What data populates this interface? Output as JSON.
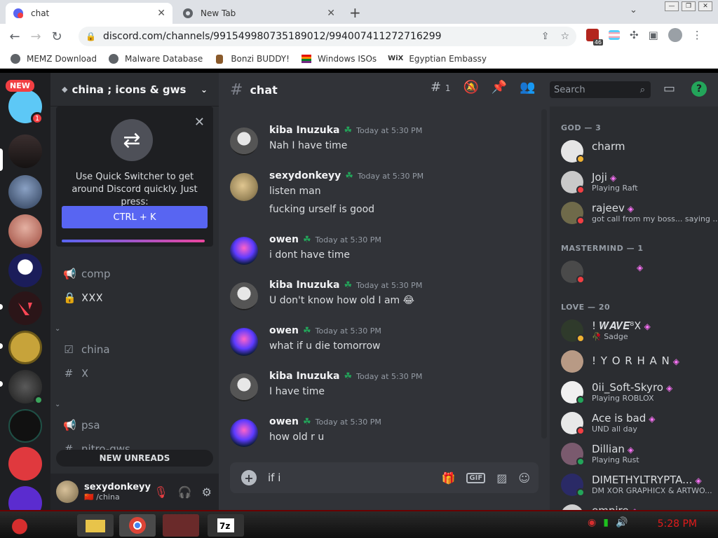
{
  "browser": {
    "tabs": [
      {
        "label": "chat",
        "active": true
      },
      {
        "label": "New Tab",
        "active": false
      }
    ],
    "url": "discord.com/channels/991549980735189012/994007411272716299",
    "extension_badge": "46",
    "bookmarks": [
      {
        "label": "MEMZ Download",
        "icon": "globe-icon"
      },
      {
        "label": "Malware Database",
        "icon": "globe-icon"
      },
      {
        "label": "Bonzi BUDDY!",
        "icon": "bonzi-icon"
      },
      {
        "label": "Windows ISOs",
        "icon": "windows-flag-icon"
      },
      {
        "label": "Egyptian Embassy",
        "icon": "wix-icon"
      }
    ],
    "bookmark_wix_label": "WiX"
  },
  "servers": {
    "new_label": "NEW",
    "badges": [
      "1",
      "1"
    ]
  },
  "sidebar": {
    "guild_name": "china ; icons & gws",
    "quick_switcher": {
      "text": "Use Quick Switcher to get around Discord quickly. Just press:",
      "shortcut": "CTRL + K"
    },
    "channels": [
      {
        "icon": "megaphone-icon",
        "label": "comp"
      },
      {
        "icon": "lock-icon",
        "label": "𐌗𐌗𐌗"
      },
      {
        "icon": "checkbox-icon",
        "label": "china"
      },
      {
        "icon": "hash-icon",
        "label": "𐌗"
      },
      {
        "icon": "megaphone-icon",
        "label": "psa"
      },
      {
        "icon": "hash-icon",
        "label": "nitro-gws"
      }
    ],
    "new_unreads": "NEW UNREADS",
    "user": {
      "name": "sexydonkeyy",
      "status": "/china",
      "flag": "🇨🇳"
    }
  },
  "chat": {
    "channel": "chat",
    "thread_count": "1",
    "search_placeholder": "Search",
    "messages": [
      {
        "author": "kiba Inuzuka",
        "time": "Today at 5:30 PM",
        "lines": [
          "Nah I have time"
        ],
        "avatar": "kiba"
      },
      {
        "author": "sexydonkeyy",
        "time": "Today at 5:30 PM",
        "lines": [
          "listen man",
          "fucking urself is good"
        ],
        "avatar": "sexy"
      },
      {
        "author": "owen",
        "time": "Today at 5:30 PM",
        "lines": [
          "i dont have time"
        ],
        "avatar": "owen"
      },
      {
        "author": "kiba Inuzuka",
        "time": "Today at 5:30 PM",
        "lines": [
          "U don't know how old I am 😂"
        ],
        "avatar": "kiba"
      },
      {
        "author": "owen",
        "time": "Today at 5:30 PM",
        "lines": [
          "what if u die tomorrow"
        ],
        "avatar": "owen"
      },
      {
        "author": "kiba Inuzuka",
        "time": "Today at 5:30 PM",
        "lines": [
          "I have time"
        ],
        "avatar": "kiba"
      },
      {
        "author": "owen",
        "time": "Today at 5:30 PM",
        "lines": [
          "how old r u"
        ],
        "avatar": "owen"
      }
    ],
    "composer_value": "if i",
    "gif_label": "GIF"
  },
  "members": {
    "groups": [
      {
        "title": "GOD — 3",
        "members": [
          {
            "name": "charm",
            "sub": "",
            "status": "idle"
          },
          {
            "name": "Joji",
            "sub": "Playing Raft",
            "status": "dnd"
          },
          {
            "name": "rajeev",
            "sub": "got call from my boss... saying ...",
            "status": "dnd"
          }
        ]
      },
      {
        "title": "MASTERMIND — 1",
        "members": [
          {
            "name": "",
            "sub": "",
            "status": "dnd"
          }
        ]
      },
      {
        "title": "LOVE — 20",
        "members": [
          {
            "name": "! 𝑾𝑨𝑽𝑬⁸𐌗",
            "sub": "Sadge",
            "status": "idle"
          },
          {
            "name": "! Y O R H A N",
            "sub": "",
            "status": "none"
          },
          {
            "name": "0ii_Soft-Skyro",
            "sub": "Playing ROBLOX",
            "status": "online"
          },
          {
            "name": "Ace is bad",
            "sub": "UND all day",
            "status": "dnd"
          },
          {
            "name": "Dillian",
            "sub": "Playing Rust",
            "status": "online"
          },
          {
            "name": "DIMETHYLTRYPTA...",
            "sub": "DM 𐌗OR GRAPHIC𐌗 & ARTWO...",
            "status": "online"
          },
          {
            "name": "empire",
            "sub": "",
            "status": "none"
          }
        ]
      }
    ]
  },
  "taskbar": {
    "clock": "5:28 PM"
  },
  "colors": {
    "blurple": "#5865f2",
    "online": "#23a55a",
    "idle": "#f0b232",
    "dnd": "#f23f43"
  }
}
